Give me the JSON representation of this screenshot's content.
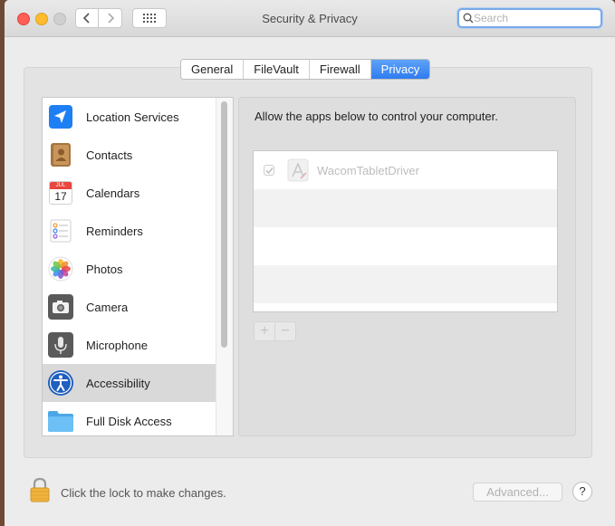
{
  "window": {
    "title": "Security & Privacy",
    "search_placeholder": "Search"
  },
  "tabs": [
    {
      "label": "General",
      "selected": false
    },
    {
      "label": "FileVault",
      "selected": false
    },
    {
      "label": "Firewall",
      "selected": false
    },
    {
      "label": "Privacy",
      "selected": true
    }
  ],
  "sidebar": {
    "items": [
      {
        "label": "Location Services",
        "icon": "location-arrow-icon"
      },
      {
        "label": "Contacts",
        "icon": "contacts-book-icon"
      },
      {
        "label": "Calendars",
        "icon": "calendar-icon"
      },
      {
        "label": "Reminders",
        "icon": "reminders-icon"
      },
      {
        "label": "Photos",
        "icon": "photos-flower-icon"
      },
      {
        "label": "Camera",
        "icon": "camera-icon"
      },
      {
        "label": "Microphone",
        "icon": "microphone-icon"
      },
      {
        "label": "Accessibility",
        "icon": "accessibility-icon",
        "selected": true
      },
      {
        "label": "Full Disk Access",
        "icon": "folder-icon"
      }
    ],
    "calendar_month": "JUL",
    "calendar_day": "17"
  },
  "detail": {
    "description": "Allow the apps below to control your computer.",
    "apps": [
      {
        "name": "WacomTabletDriver",
        "checked": true,
        "enabled": false
      }
    ],
    "add_label": "+",
    "remove_label": "−"
  },
  "footer": {
    "lock_text": "Click the lock to make changes.",
    "advanced_label": "Advanced...",
    "help_label": "?"
  },
  "colors": {
    "accent": "#2f7cf0",
    "selection": "#d9d9d9",
    "close": "#fe5f57",
    "minimize": "#febc2e"
  }
}
